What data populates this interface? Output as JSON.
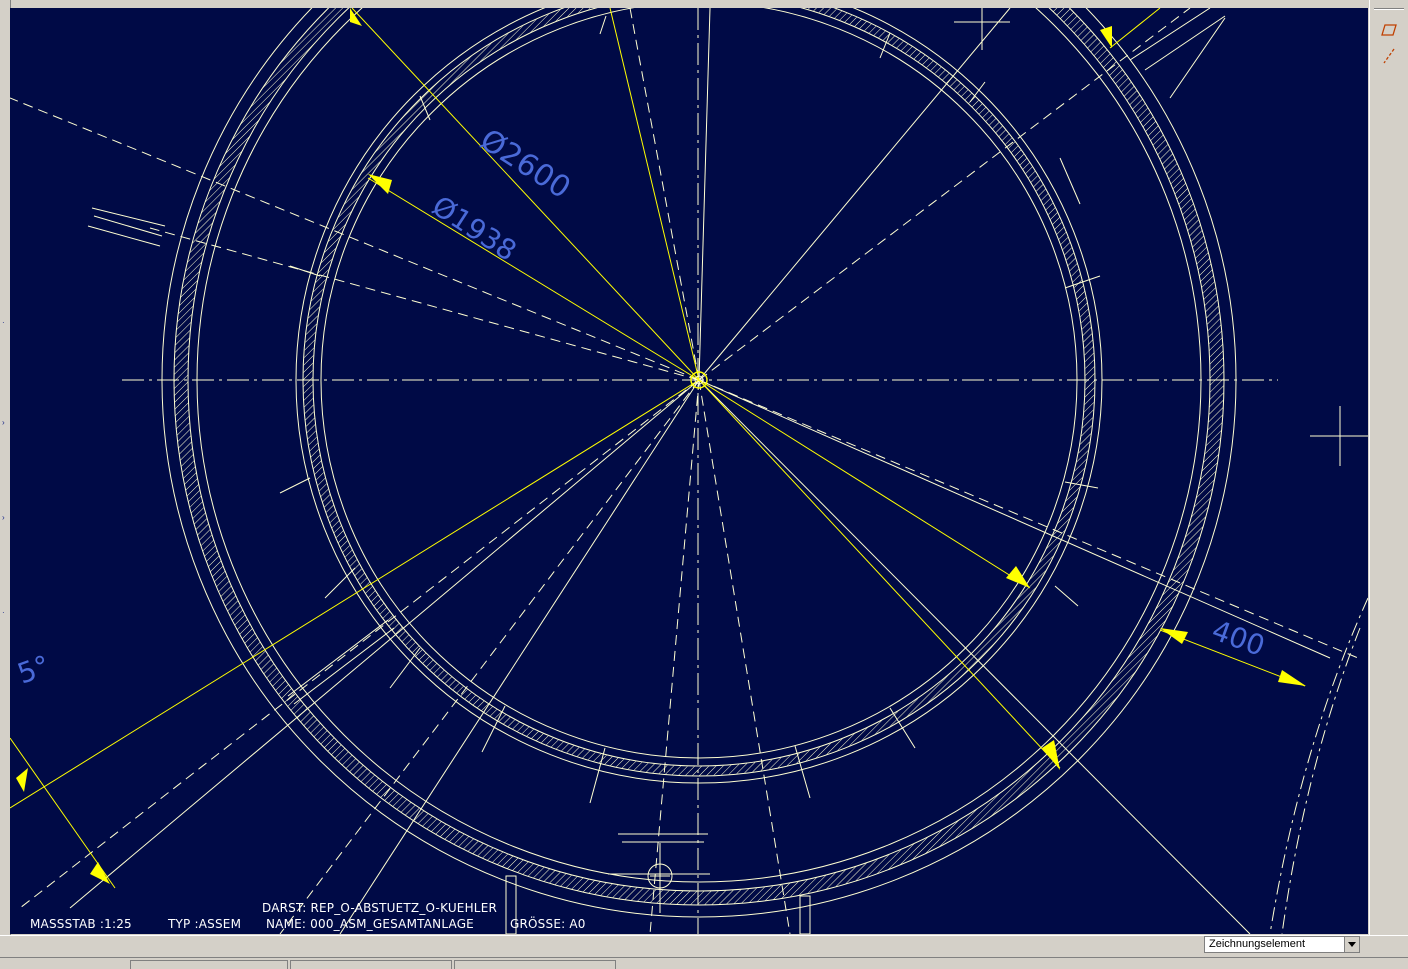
{
  "drawing": {
    "colors": {
      "background": "#000a46",
      "geometry": "#ffffd2",
      "dimension": "#ffff00",
      "dimension_text": "#4a6ad8"
    },
    "dimensions": {
      "outer_diameter": "Ø2600",
      "inner_diameter": "Ø1938",
      "wall_offset": "400",
      "angle": "5°"
    }
  },
  "title_block": {
    "massstab": "MASSSTAB :1:25",
    "typ": "TYP :ASSEM",
    "darst": "DARST: REP_O-ABSTUETZ_O-KUEHLER",
    "name": "NAME: 000_ASM_GESAMTANLAGE",
    "groesse": "GRÖSSE: A0"
  },
  "right_toolbar": {
    "tools": [
      {
        "icon": "parallelogram-icon"
      },
      {
        "icon": "dashed-line-icon"
      }
    ]
  },
  "statusbar": {
    "filter_value": "Zeichnungselement"
  }
}
